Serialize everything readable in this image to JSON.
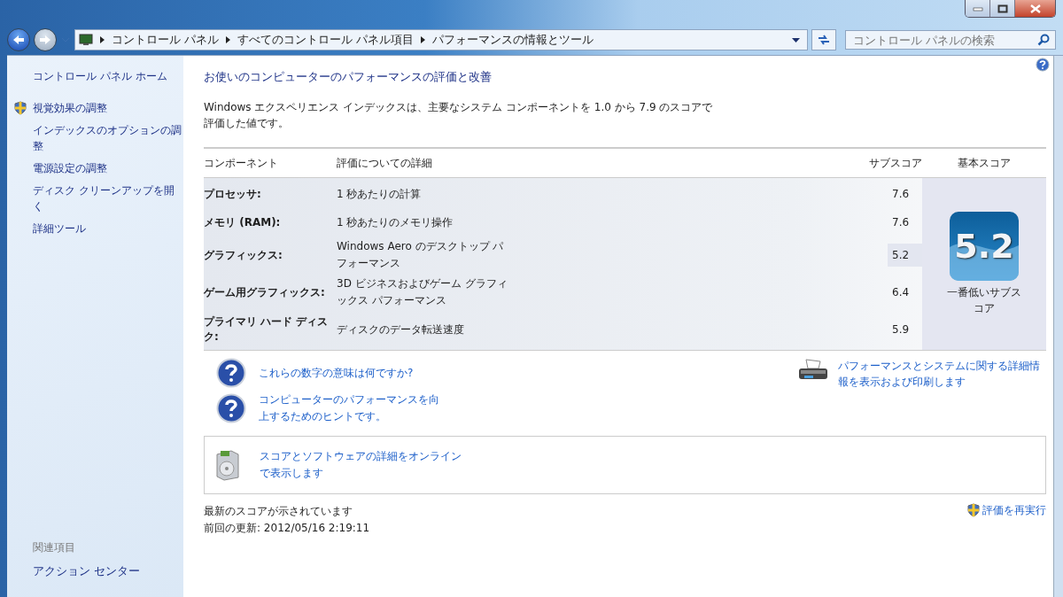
{
  "address_bar": {
    "breadcrumbs": [
      "コントロール パネル",
      "すべてのコントロール パネル項目",
      "パフォーマンスの情報とツール"
    ]
  },
  "search": {
    "placeholder": "コントロール パネルの検索"
  },
  "sidebar": {
    "items": [
      {
        "label": "コントロール パネル ホーム",
        "shield": false
      },
      {
        "label": "視覚効果の調整",
        "shield": true
      },
      {
        "label": "インデックスのオプションの調整",
        "shield": false
      },
      {
        "label": "電源設定の調整",
        "shield": false
      },
      {
        "label": "ディスク クリーンアップを開く",
        "shield": false
      },
      {
        "label": "詳細ツール",
        "shield": false
      }
    ],
    "related_heading": "関連項目",
    "related": [
      "アクション センター"
    ]
  },
  "main": {
    "title": "お使いのコンピューターのパフォーマンスの評価と改善",
    "description": "Windows エクスペリエンス インデックスは、主要なシステム コンポーネントを 1.0 から 7.9 のスコアで評価した値です。",
    "table": {
      "columns": [
        "コンポーネント",
        "評価についての詳細",
        "サブスコア",
        "基本スコア"
      ],
      "rows": [
        {
          "component": "プロセッサ:",
          "detail": "1 秒あたりの計算",
          "subscore": "7.6",
          "lowest": false
        },
        {
          "component": "メモリ (RAM):",
          "detail": "1 秒あたりのメモリ操作",
          "subscore": "7.6",
          "lowest": false
        },
        {
          "component": "グラフィックス:",
          "detail": "Windows Aero のデスクトップ パフォーマンス",
          "subscore": "5.2",
          "lowest": true
        },
        {
          "component": "ゲーム用グラフィックス:",
          "detail": "3D ビジネスおよびゲーム グラフィックス パフォーマンス",
          "subscore": "6.4",
          "lowest": false
        },
        {
          "component": "プライマリ ハード ディスク:",
          "detail": "ディスクのデータ転送速度",
          "subscore": "5.9",
          "lowest": false
        }
      ],
      "base_score": "5.2",
      "base_caption": "一番低いサブスコア"
    },
    "help_links": [
      "これらの数字の意味は何ですか?",
      "コンピューターのパフォーマンスを向上するためのヒントです。"
    ],
    "print_link": "パフォーマンスとシステムに関する詳細情報を表示および印刷します",
    "online_link": "スコアとソフトウェアの詳細をオンラインで表示します",
    "status": "最新のスコアが示されています",
    "last_update": "前回の更新: 2012/05/16 2:19:11",
    "rerun_link": "評価を再実行"
  }
}
